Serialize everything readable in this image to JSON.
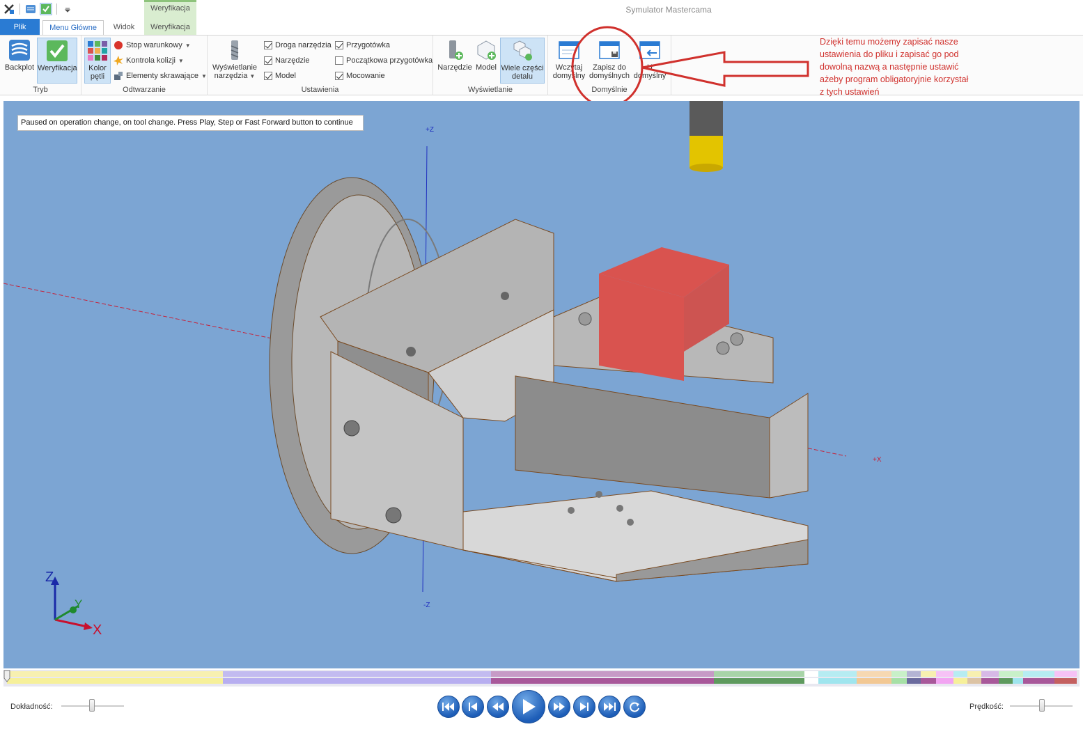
{
  "window": {
    "title": "Symulator Mastercama",
    "context_header": "Weryfikacja"
  },
  "tabs": {
    "file": "Plik",
    "home": "Menu Główne",
    "view": "Widok",
    "verify": "Weryfikacja"
  },
  "ribbon": {
    "tryb": {
      "label": "Tryb",
      "backplot": "Backplot",
      "weryfikacja": "Weryfikacja"
    },
    "odtwarzanie": {
      "label": "Odtwarzanie",
      "kolor_line1": "Kolor",
      "kolor_line2": "pętli",
      "stop": "Stop warunkowy",
      "kolizje": "Kontrola kolizji",
      "elementy": "Elementy skrawające"
    },
    "ustawienia": {
      "label": "Ustawienia",
      "wysw_line1": "Wyświetlanie",
      "wysw_line2": "narzędzia",
      "droga": "Droga narzędzia",
      "narzedzie": "Narzędzie",
      "model": "Model",
      "przygotowka": "Przygotówka",
      "poczatkowa": "Początkowa przygotówka",
      "mocowanie": "Mocowanie",
      "checked": {
        "droga": true,
        "narzedzie": true,
        "model": true,
        "przygotowka": true,
        "poczatkowa": false,
        "mocowanie": true
      }
    },
    "wyswietlanie": {
      "label": "Wyświetlanie",
      "narzedzie": "Narzędzie",
      "model": "Model",
      "wiele_line1": "Wiele części",
      "wiele_line2": "detalu"
    },
    "domyslnie": {
      "label": "Domyślnie",
      "wczytaj_line1": "Wczytaj",
      "wczytaj_line2": "domyślny",
      "zapisz_line1": "Zapisz do",
      "zapisz_line2": "domyślnych",
      "third_line1": "U",
      "third_line2": "domyślny"
    }
  },
  "annotation": {
    "line1": "Dzięki temu możemy zapisać nasze",
    "line2": "ustawienia do pliku i zapisać go pod",
    "line3": "dowolną nazwą a następnie ustawić",
    "line4": "ażeby program obligatoryjnie korzystał",
    "line5": "z tych ustawień",
    "color": "#d0312d"
  },
  "viewport": {
    "status_message": "Paused on operation change, on tool change. Press Play, Step or Fast Forward button to continue",
    "axis_z_pos": "+Z",
    "axis_z_neg": "-Z",
    "axis_x_pos": "+X",
    "triad_z": "Z",
    "triad_y": "Y",
    "triad_x": "X",
    "background": "#7ca5d3"
  },
  "bottom": {
    "dokladnosc": "Dokładność:",
    "predkosc": "Prędkość:"
  },
  "colors": {
    "accent": "#2a7bd3",
    "context_tab": "#d9edd0",
    "stock": "#d9534f"
  }
}
